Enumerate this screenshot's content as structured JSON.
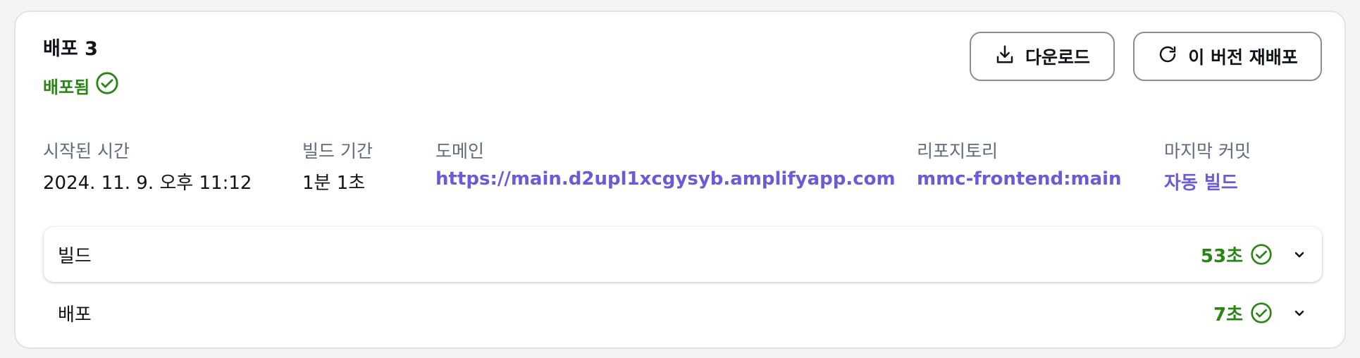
{
  "deployment": {
    "title": "배포 3",
    "status": "배포됨"
  },
  "actions": {
    "download_label": "다운로드",
    "redeploy_label": "이 버전 재배포"
  },
  "meta": {
    "started_label": "시작된 시간",
    "started_value": "2024. 11. 9. 오후 11:12",
    "duration_label": "빌드 기간",
    "duration_value": "1분 1초",
    "domain_label": "도메인",
    "domain_value": "https://main.d2upl1xcgysyb.amplifyapp.com",
    "repo_label": "리포지토리",
    "repo_value": "mmc-frontend:main",
    "commit_label": "마지막 커밋",
    "commit_value": "자동 빌드"
  },
  "steps": [
    {
      "label": "빌드",
      "duration": "53초"
    },
    {
      "label": "배포",
      "duration": "7초"
    }
  ],
  "colors": {
    "success": "#2a8614",
    "link": "#6a5bd6",
    "muted": "#5f6b7a"
  }
}
